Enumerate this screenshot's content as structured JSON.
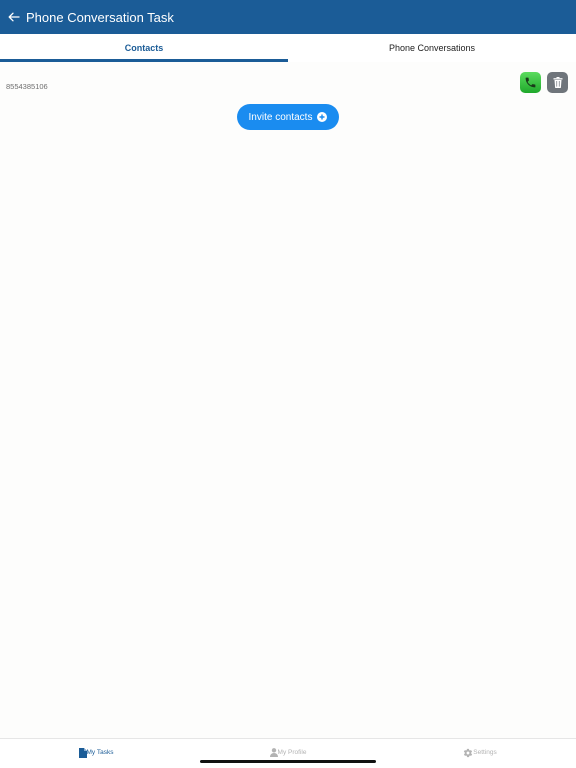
{
  "header": {
    "title": "Phone Conversation Task",
    "back_icon": "arrow-left-icon"
  },
  "tabs": [
    {
      "label": "Contacts",
      "active": true
    },
    {
      "label": "Phone Conversations",
      "active": false
    }
  ],
  "contacts": [
    {
      "number": "8554385106",
      "call_icon": "phone-icon",
      "delete_icon": "trash-icon"
    }
  ],
  "invite": {
    "label": "Invite contacts",
    "icon": "plus-circle-icon"
  },
  "bottom_nav": [
    {
      "label": "My Tasks",
      "icon": "document-icon",
      "active": true
    },
    {
      "label": "My Profile",
      "icon": "user-icon",
      "active": false
    },
    {
      "label": "Settings",
      "icon": "gear-icon",
      "active": false
    }
  ],
  "colors": {
    "header": "#1b5c97",
    "accent": "#1a8cf0",
    "call": "#34c23c",
    "delete": "#6f757b"
  }
}
